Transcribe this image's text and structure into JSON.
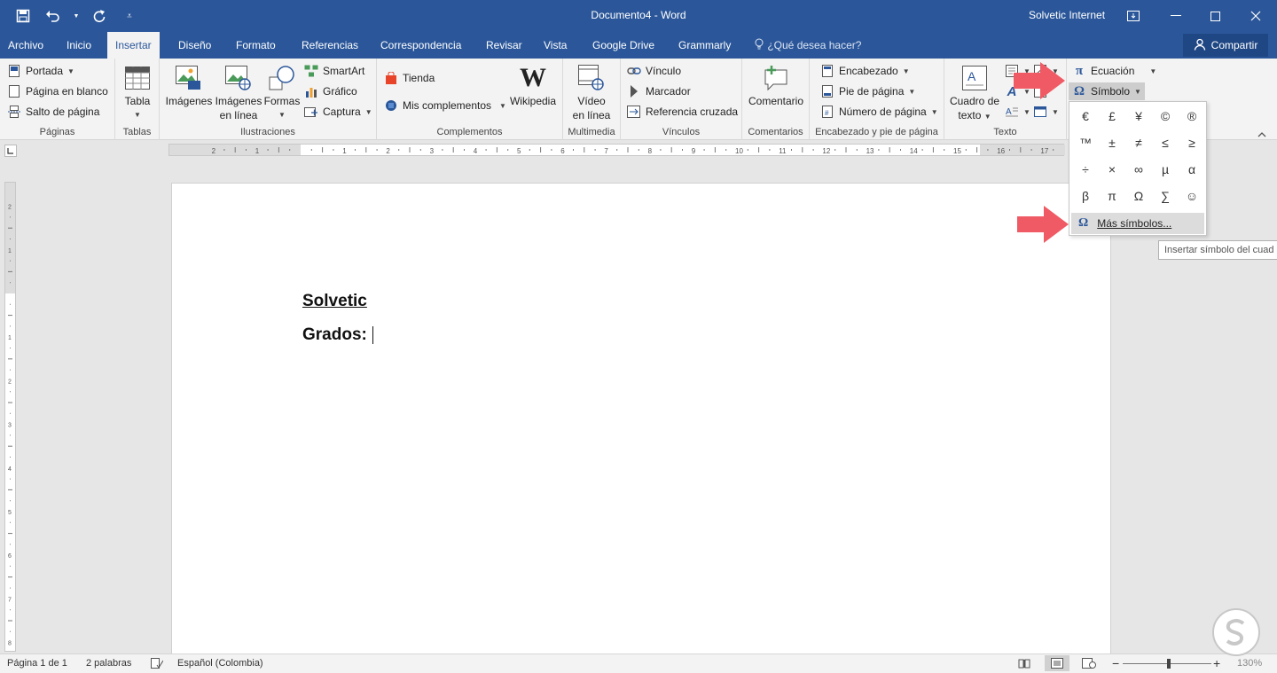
{
  "window": {
    "title": "Documento4  -  Word",
    "account": "Solvetic Internet"
  },
  "tabs": [
    {
      "label": "Archivo"
    },
    {
      "label": "Inicio"
    },
    {
      "label": "Insertar"
    },
    {
      "label": "Diseño"
    },
    {
      "label": "Formato"
    },
    {
      "label": "Referencias"
    },
    {
      "label": "Correspondencia"
    },
    {
      "label": "Revisar"
    },
    {
      "label": "Vista"
    },
    {
      "label": "Google Drive"
    },
    {
      "label": "Grammarly"
    }
  ],
  "tellme": "¿Qué desea hacer?",
  "share_label": "Compartir",
  "ribbon": {
    "paginas": {
      "label": "Páginas",
      "portada": "Portada",
      "blank": "Página en blanco",
      "break": "Salto de página"
    },
    "tablas": {
      "label": "Tablas",
      "tabla": "Tabla"
    },
    "ilustraciones": {
      "label": "Ilustraciones",
      "imagenes": "Imágenes",
      "imagenes_linea_1": "Imágenes",
      "imagenes_linea_2": "en línea",
      "formas": "Formas",
      "smartart": "SmartArt",
      "grafico": "Gráfico",
      "captura": "Captura"
    },
    "complementos": {
      "label": "Complementos",
      "tienda": "Tienda",
      "mis": "Mis complementos",
      "wikipedia": "Wikipedia"
    },
    "multimedia": {
      "label": "Multimedia",
      "video_1": "Vídeo",
      "video_2": "en línea"
    },
    "vinculos": {
      "label": "Vínculos",
      "vinculo": "Vínculo",
      "marcador": "Marcador",
      "referencia": "Referencia cruzada"
    },
    "comentarios": {
      "label": "Comentarios",
      "comentario": "Comentario"
    },
    "encabezado": {
      "label": "Encabezado y pie de página",
      "encabezado": "Encabezado",
      "pie": "Pie de página",
      "numero": "Número de página"
    },
    "texto": {
      "label": "Texto",
      "cuadro_1": "Cuadro de",
      "cuadro_2": "texto"
    },
    "simbolos": {
      "ecuacion": "Ecuación",
      "simbolo": "Símbolo"
    }
  },
  "symbol_menu": {
    "symbols": [
      "€",
      "£",
      "¥",
      "©",
      "®",
      "™",
      "±",
      "≠",
      "≤",
      "≥",
      "÷",
      "×",
      "∞",
      "µ",
      "α",
      "β",
      "π",
      "Ω",
      "∑",
      "☺"
    ],
    "more": "Más símbolos...",
    "tooltip": "Insertar símbolo del cuad"
  },
  "document": {
    "line1": "Solvetic",
    "line2": "Grados:"
  },
  "statusbar": {
    "page": "Página 1 de 1",
    "words": "2 palabras",
    "language": "Español (Colombia)",
    "zoom": "130%"
  },
  "colors": {
    "word_blue": "#2b579a",
    "arrow_red": "#f05a64"
  }
}
